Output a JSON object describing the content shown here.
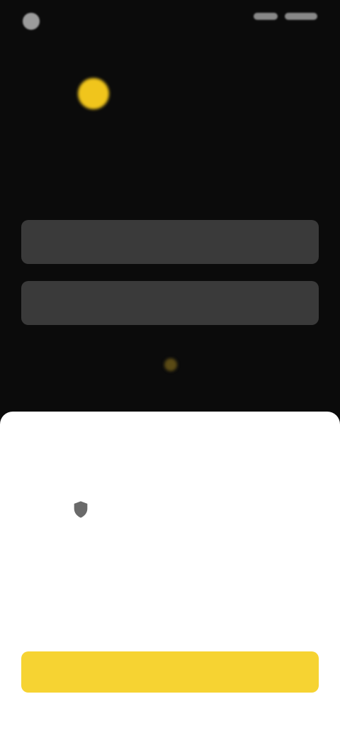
{
  "status_bar": {
    "time": ""
  },
  "brand": {
    "name": "",
    "subtitle": ""
  },
  "form": {
    "email_placeholder": "",
    "password_placeholder": ""
  },
  "sheet": {
    "top_label": "",
    "heading": "",
    "body": "",
    "cta_label": ""
  },
  "colors": {
    "accent": "#f6d332",
    "background": "#0b0b0b",
    "field": "#3a3a3a"
  },
  "icons": {
    "brand": "brand-logo-icon",
    "security": "shield-icon"
  }
}
